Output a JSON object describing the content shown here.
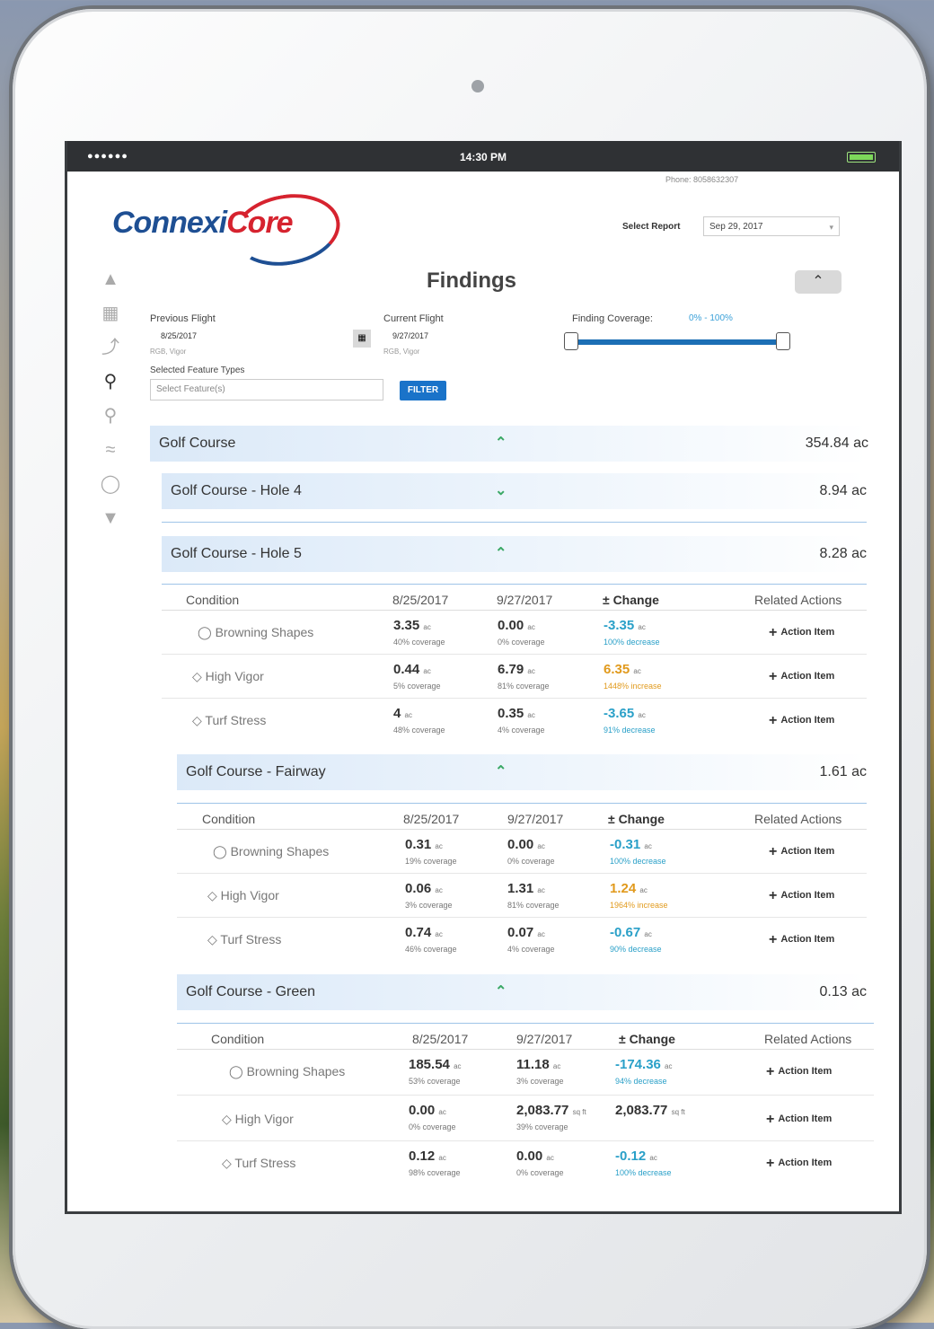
{
  "status_bar": {
    "signal": "●●●●●●",
    "time": "14:30 PM"
  },
  "phone": "Phone: 8058632307",
  "logo": {
    "part1": "Connexi",
    "part2": "Core"
  },
  "report": {
    "label": "Select Report",
    "selected": "Sep 29, 2017"
  },
  "page_title": "Findings",
  "filters": {
    "previous_flight_label": "Previous Flight",
    "previous_flight_date": "8/25/2017",
    "previous_flight_sub": "RGB, Vigor",
    "current_flight_label": "Current Flight",
    "current_flight_date": "9/27/2017",
    "current_flight_sub": "RGB, Vigor",
    "feature_types_label": "Selected Feature Types",
    "feature_placeholder": "Select Feature(s)",
    "filter_button": "FILTER",
    "coverage_label": "Finding Coverage:",
    "coverage_range": "0% - 100%"
  },
  "groups": {
    "course": {
      "name": "Golf Course",
      "area": "354.84 ac"
    },
    "hole4": {
      "name": "Golf Course - Hole 4",
      "area": "8.94 ac"
    },
    "hole5": {
      "name": "Golf Course - Hole 5",
      "area": "8.28 ac"
    },
    "fairway": {
      "name": "Golf Course - Fairway",
      "area": "1.61 ac"
    },
    "green": {
      "name": "Golf Course - Green",
      "area": "0.13 ac"
    }
  },
  "table_headers": {
    "condition": "Condition",
    "prev": "8/25/2017",
    "curr": "9/27/2017",
    "change": "± Change",
    "actions": "Related Actions"
  },
  "action_label": "Action Item",
  "hole5": {
    "r1": {
      "cond": "Browning Shapes",
      "pv": "3.35",
      "pu": "ac",
      "pc": "40% coverage",
      "cv": "0.00",
      "cu": "ac",
      "cc": "0% coverage",
      "chv": "-3.35",
      "chu": "ac",
      "chc": "100% decrease"
    },
    "r2": {
      "cond": "High Vigor",
      "pv": "0.44",
      "pu": "ac",
      "pc": "5% coverage",
      "cv": "6.79",
      "cu": "ac",
      "cc": "81% coverage",
      "chv": "6.35",
      "chu": "ac",
      "chc": "1448% increase"
    },
    "r3": {
      "cond": "Turf Stress",
      "pv": "4",
      "pu": "ac",
      "pc": "48% coverage",
      "cv": "0.35",
      "cu": "ac",
      "cc": "4% coverage",
      "chv": "-3.65",
      "chu": "ac",
      "chc": "91% decrease"
    }
  },
  "fairway": {
    "r1": {
      "cond": "Browning Shapes",
      "pv": "0.31",
      "pu": "ac",
      "pc": "19% coverage",
      "cv": "0.00",
      "cu": "ac",
      "cc": "0% coverage",
      "chv": "-0.31",
      "chu": "ac",
      "chc": "100% decrease"
    },
    "r2": {
      "cond": "High Vigor",
      "pv": "0.06",
      "pu": "ac",
      "pc": "3% coverage",
      "cv": "1.31",
      "cu": "ac",
      "cc": "81% coverage",
      "chv": "1.24",
      "chu": "ac",
      "chc": "1964% increase"
    },
    "r3": {
      "cond": "Turf Stress",
      "pv": "0.74",
      "pu": "ac",
      "pc": "46% coverage",
      "cv": "0.07",
      "cu": "ac",
      "cc": "4% coverage",
      "chv": "-0.67",
      "chu": "ac",
      "chc": "90% decrease"
    }
  },
  "green": {
    "r1": {
      "cond": "Browning Shapes",
      "pv": "185.54",
      "pu": "ac",
      "pc": "53% coverage",
      "cv": "11.18",
      "cu": "ac",
      "cc": "3% coverage",
      "chv": "-174.36",
      "chu": "ac",
      "chc": "94% decrease"
    },
    "r2": {
      "cond": "High Vigor",
      "pv": "0.00",
      "pu": "ac",
      "pc": "0% coverage",
      "cv": "2,083.77",
      "cu": "sq ft",
      "cc": "39% coverage",
      "chv": "2,083.77",
      "chu": "sq ft",
      "chc": ""
    },
    "r3": {
      "cond": "Turf Stress",
      "pv": "0.12",
      "pu": "ac",
      "pc": "98% coverage",
      "cv": "0.00",
      "cu": "ac",
      "cc": "0% coverage",
      "chv": "-0.12",
      "chu": "ac",
      "chc": "100% decrease"
    }
  },
  "colors": {
    "accent": "#1a73c9",
    "decrease": "#2aa0c8",
    "increase": "#e19a1d",
    "chevron": "#3aa865"
  }
}
